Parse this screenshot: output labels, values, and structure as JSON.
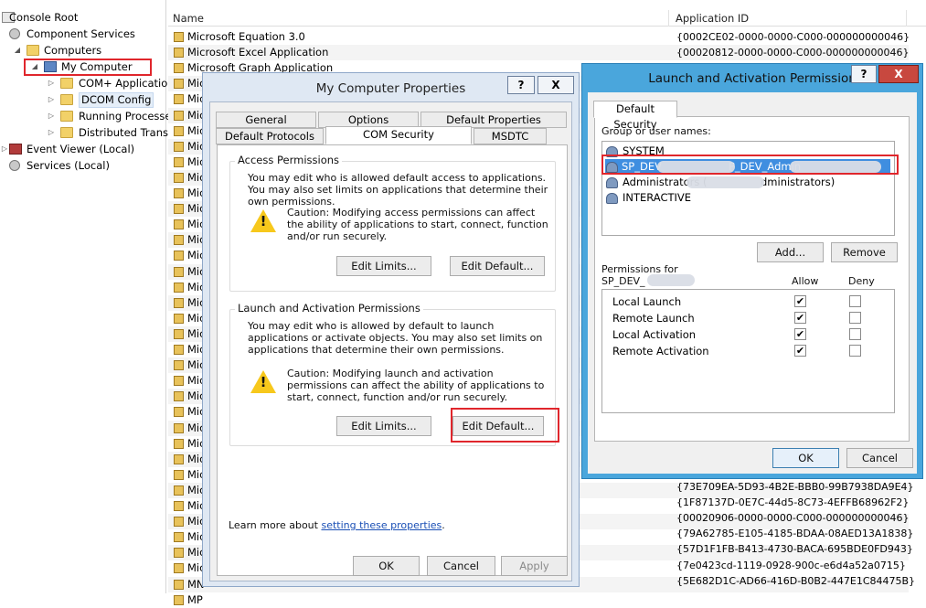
{
  "tree": {
    "items": [
      {
        "label": "Console Root",
        "icon": "console-icon"
      },
      {
        "label": "Component Services",
        "icon": "gear-icon"
      },
      {
        "label": "Computers",
        "icon": "folder-icon"
      },
      {
        "label": "My Computer",
        "icon": "computer-icon"
      },
      {
        "label": "COM+ Applicatio",
        "icon": "folder-icon"
      },
      {
        "label": "DCOM Config",
        "icon": "folder-icon"
      },
      {
        "label": "Running Processe",
        "icon": "folder-icon"
      },
      {
        "label": "Distributed Trans",
        "icon": "folder-icon"
      },
      {
        "label": "Event Viewer (Local)",
        "icon": "event-viewer-icon"
      },
      {
        "label": "Services (Local)",
        "icon": "gear-icon"
      }
    ]
  },
  "list": {
    "col_name": "Name",
    "col_appid": "Application ID",
    "rows": [
      "Microsoft Equation 3.0",
      "Microsoft Excel Application",
      "Microsoft Graph Application",
      "Mic",
      "Mic",
      "Mic",
      "Mic",
      "Mic",
      "Mic",
      "Mic",
      "Mic",
      "Mic",
      "Mic",
      "Mic",
      "Mic",
      "Mic",
      "Mic",
      "Mic",
      "Mic",
      "Mic",
      "Mic",
      "Mic",
      "Mic",
      "Mic",
      "Mic",
      "Mic",
      "Mic",
      "Mic",
      "Mic",
      "Mic",
      "Mic",
      "Mic",
      "Mic",
      "Mic",
      "Mic",
      "MN",
      "MP"
    ],
    "app_ids": [
      "{0002CE02-0000-0000-C000-000000000046}",
      "{00020812-0000-0000-C000-000000000046}"
    ],
    "app_ids_bottom": [
      "{73E709EA-5D93-4B2E-BBB0-99B7938DA9E4}",
      "{1F87137D-0E7C-44d5-8C73-4EFFB68962F2}",
      "{00020906-0000-0000-C000-000000000046}",
      "{79A62785-E105-4185-BDAA-08AED13A1838}",
      "{57D1F1FB-B413-4730-BACA-695BDE0FD943}",
      "{7e0423cd-1119-0928-900c-e6d4a52a0715}",
      "{5E682D1C-AD66-416D-B0B2-447E1C84475B}"
    ]
  },
  "dialog1": {
    "title": "My Computer Properties",
    "help": "?",
    "close": "X",
    "tabs_row1": [
      "General",
      "Options",
      "Default Properties"
    ],
    "tabs_row2": [
      "Default Protocols",
      "COM Security",
      "MSDTC"
    ],
    "access": {
      "label": "Access Permissions",
      "desc": "You may edit who is allowed default access to applications. You may also set limits on applications that determine their own permissions.",
      "caution": "Caution: Modifying access permissions can affect the ability of applications to start, connect, function and/or run securely.",
      "edit_limits": "Edit Limits...",
      "edit_default": "Edit Default..."
    },
    "launch": {
      "label": "Launch and Activation Permissions",
      "desc": "You may edit who is allowed by default to launch applications or activate objects. You may also set limits on applications that determine their own permissions.",
      "caution": "Caution: Modifying launch and activation permissions can affect the ability of applications to start, connect, function and/or run securely.",
      "edit_limits": "Edit Limits...",
      "edit_default": "Edit Default..."
    },
    "learn_prefix": "Learn more about ",
    "learn_link": "setting these properties",
    "learn_suffix": ".",
    "ok": "OK",
    "cancel": "Cancel",
    "apply": "Apply"
  },
  "dialog2": {
    "title": "Launch and Activation Permission",
    "help": "?",
    "close": "X",
    "tab": "Default Security",
    "group_label": "Group or user names:",
    "users": [
      {
        "a": "SYSTEM",
        "b": ""
      },
      {
        "a": "SP_DEV",
        "b": "P_DEV_Admin"
      },
      {
        "a": "Administrators (",
        "b": "dministrators)"
      },
      {
        "a": "INTERACTIVE",
        "b": ""
      }
    ],
    "add": "Add...",
    "remove": "Remove",
    "perm_for": "Permissions for",
    "perm_user": "SP_DEV_",
    "allow": "Allow",
    "deny": "Deny",
    "permissions": [
      {
        "name": "Local Launch",
        "allow": true,
        "deny": false
      },
      {
        "name": "Remote Launch",
        "allow": true,
        "deny": false
      },
      {
        "name": "Local Activation",
        "allow": true,
        "deny": false
      },
      {
        "name": "Remote Activation",
        "allow": true,
        "deny": false
      }
    ],
    "ok": "OK",
    "cancel": "Cancel"
  },
  "colors": {
    "highlight": "#e0262c",
    "selection": "#3f8ee0",
    "frame": "#4aa6dc"
  }
}
